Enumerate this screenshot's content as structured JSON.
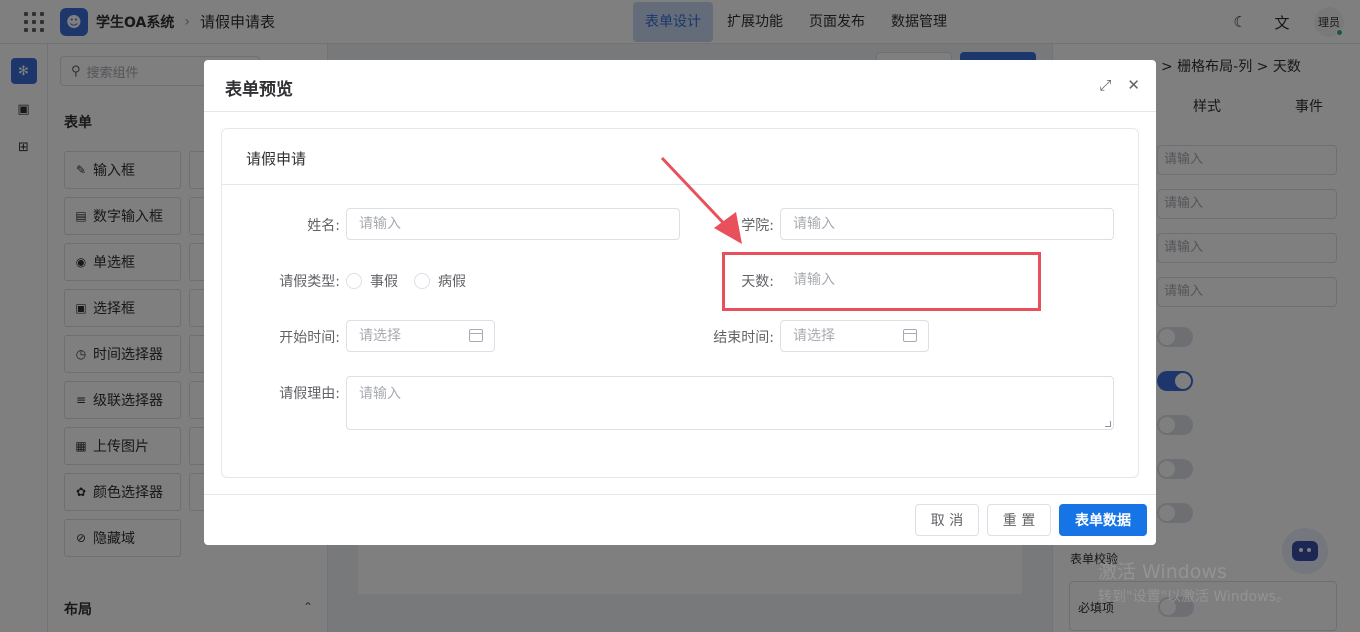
{
  "topbar": {
    "app_title": "学生OA系统",
    "page_name": "请假申请表",
    "nav": [
      "表单设计",
      "扩展功能",
      "页面发布",
      "数据管理"
    ],
    "active_nav": "表单设计",
    "theme_icon": "moon-icon",
    "translate_icon": "translate-icon",
    "avatar_text": "理员"
  },
  "left_panel": {
    "search_placeholder": "搜索组件",
    "section_form": "表单",
    "components": [
      "输入框",
      "数字输入框",
      "单选框",
      "选择框",
      "时间选择器",
      "级联选择器",
      "上传图片",
      "颜色选择器",
      "隐藏域"
    ],
    "section_layout": "布局"
  },
  "right_panel": {
    "breadcrumb": "> 栅格布局-列 > 天数",
    "tabs": [
      "样式",
      "事件"
    ],
    "input_placeholder": "请输入",
    "validation_label": "表单校验",
    "required_label": "必填项"
  },
  "watermark": {
    "line1": "激活 Windows",
    "line2": "转到\"设置\"以激活 Windows。"
  },
  "modal": {
    "title": "表单预览",
    "card_title": "请假申请",
    "fields": {
      "name_label": "姓名:",
      "name_placeholder": "请输入",
      "college_label": "学院:",
      "college_placeholder": "请输入",
      "leave_type_label": "请假类型:",
      "leave_type_options": [
        "事假",
        "病假"
      ],
      "days_label": "天数:",
      "days_placeholder": "请输入",
      "start_label": "开始时间:",
      "start_placeholder": "请选择",
      "end_label": "结束时间:",
      "end_placeholder": "请选择",
      "reason_label": "请假理由:",
      "reason_placeholder": "请输入"
    },
    "buttons": {
      "cancel": "取 消",
      "reset": "重 置",
      "submit": "表单数据"
    }
  },
  "colors": {
    "primary": "#1774e5",
    "highlight": "#e8505b"
  }
}
